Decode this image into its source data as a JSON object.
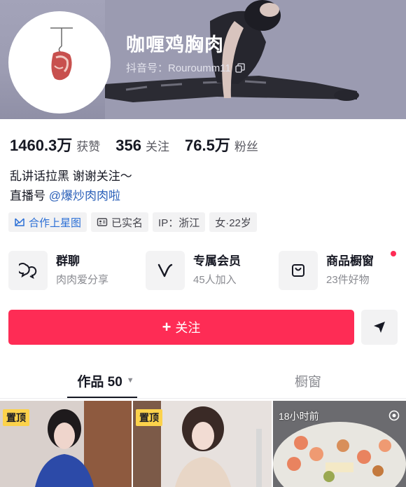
{
  "profile": {
    "nickname": "咖喱鸡胸肉",
    "douyin_id": "抖音号：Rouroumm11"
  },
  "stats": [
    {
      "value": "1460.3万",
      "label": "获赞"
    },
    {
      "value": "356",
      "label": "关注"
    },
    {
      "value": "76.5万",
      "label": "粉丝"
    }
  ],
  "bio": {
    "line1": "乱讲话拉黑 谢谢关注～",
    "line2_prefix": "直播号 ",
    "line2_link": "@爆炒肉肉啦"
  },
  "tags": {
    "star": "合作上星图",
    "verified": "已实名",
    "ip": "IP：浙江",
    "gender_age": "女·22岁"
  },
  "features": {
    "group_chat": {
      "title": "群聊",
      "subtitle": "肉肉爱分享"
    },
    "membership": {
      "title": "专属会员",
      "subtitle": "45人加入"
    },
    "shop": {
      "title": "商品橱窗",
      "subtitle": "23件好物"
    }
  },
  "actions": {
    "follow_plus": "+",
    "follow_label": "关注"
  },
  "tabs": {
    "works": "作品 50",
    "showcase": "橱窗"
  },
  "videos": [
    {
      "badge": "置顶"
    },
    {
      "badge": "置顶"
    },
    {
      "time": "18小时前"
    }
  ],
  "colors": {
    "accent": "#fe2c55",
    "link": "#2a5fb8",
    "star_tag": "#2b6fd6",
    "pin_badge": "#fcd24b"
  }
}
